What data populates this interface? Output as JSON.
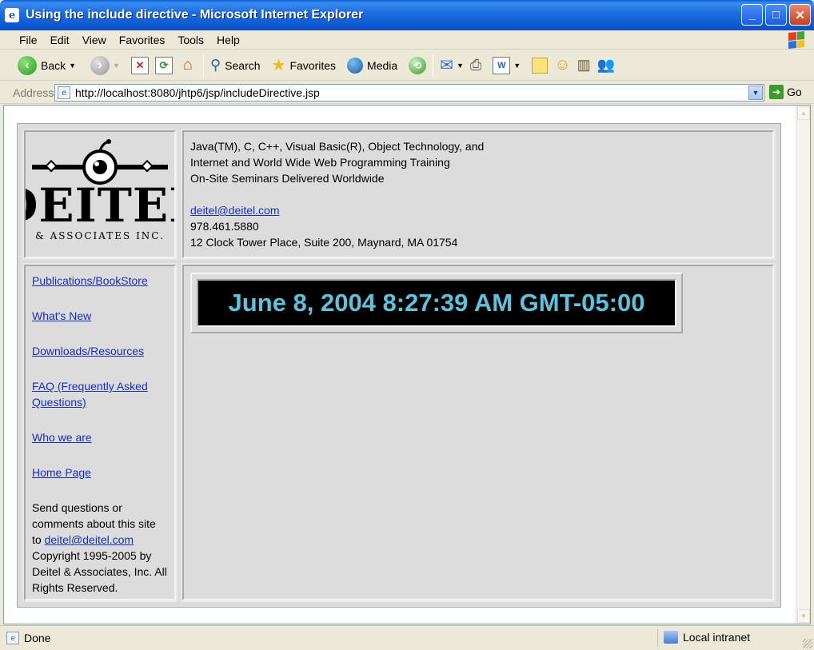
{
  "window": {
    "title": "Using the include directive - Microsoft Internet Explorer",
    "min_glyph": "_",
    "max_glyph": "□",
    "close_glyph": "✕"
  },
  "menu": [
    "File",
    "Edit",
    "View",
    "Favorites",
    "Tools",
    "Help"
  ],
  "toolbar": {
    "back_label": "Back",
    "search_label": "Search",
    "favorites_label": "Favorites",
    "media_label": "Media"
  },
  "address": {
    "label": "Address",
    "url": "http://localhost:8080/jhtp6/jsp/includeDirective.jsp",
    "go_label": "Go"
  },
  "page": {
    "logo": {
      "brand": "DEITEL",
      "sub": "& ASSOCIATES INC."
    },
    "info": {
      "line1": "Java(TM), C, C++, Visual Basic(R), Object Technology, and",
      "line2": "Internet and World Wide Web Programming Training",
      "line3": "On-Site Seminars Delivered Worldwide",
      "email": "deitel@deitel.com",
      "phone": "978.461.5880",
      "address": "12 Clock Tower Place, Suite 200, Maynard, MA 01754"
    },
    "nav": [
      "Publications/BookStore",
      "What's New",
      "Downloads/Resources",
      "FAQ (Frequently Asked Questions)",
      "Who we are",
      "Home Page"
    ],
    "footer": {
      "line_a": "Send questions or comments about this site to ",
      "email": "deitel@deitel.com",
      "line_b": "Copyright 1995-2005 by Deitel & Associates, Inc. All Rights Reserved."
    },
    "clock": "June 8, 2004 8:27:39 AM GMT-05:00"
  },
  "status": {
    "text": "Done",
    "zone": "Local intranet"
  },
  "colors": {
    "titlebar": "#0d58d0",
    "clock_text": "#5fc2dc",
    "link": "#1a2fb0"
  }
}
